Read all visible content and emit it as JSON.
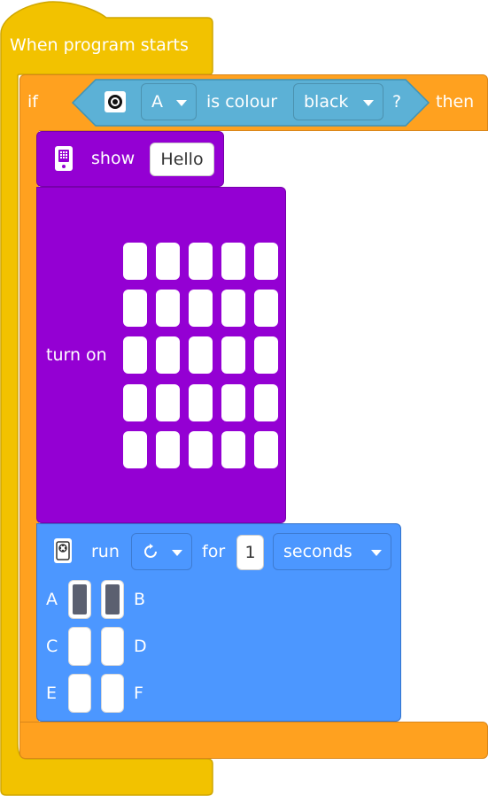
{
  "hat": {
    "label": "When program starts"
  },
  "if_block": {
    "if_label": "if",
    "then_label": "then",
    "condition": {
      "port": "A",
      "is_colour_label": "is colour",
      "colour": "black",
      "question": "?"
    }
  },
  "show_block": {
    "label": "show",
    "value": "Hello"
  },
  "turn_on_block": {
    "label": "turn on",
    "matrix_rows": 5,
    "matrix_cols": 5
  },
  "run_block": {
    "run_label": "run",
    "direction_icon": "clockwise-icon",
    "for_label": "for",
    "duration": "1",
    "unit": "seconds",
    "motors": [
      {
        "left": "A",
        "right": "B",
        "left_on": true,
        "right_on": true
      },
      {
        "left": "C",
        "right": "D",
        "left_on": false,
        "right_on": false
      },
      {
        "left": "E",
        "right": "F",
        "left_on": false,
        "right_on": false
      }
    ]
  },
  "colors": {
    "event": "#F2C200",
    "control": "#FFA11F",
    "sensing": "#5CB1D6",
    "display": "#9400D3",
    "motor": "#4C97FF"
  }
}
